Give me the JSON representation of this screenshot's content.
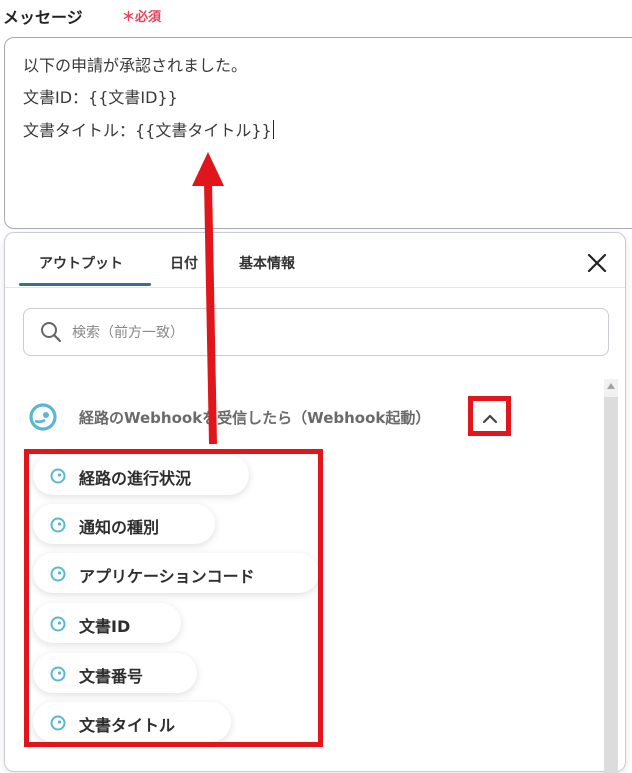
{
  "field": {
    "label": "メッセージ",
    "required": "＊必須"
  },
  "message": {
    "lines": [
      "以下の申請が承認されました。",
      "文書ID：{{文書ID}}",
      "文書タイトル：{{文書タイトル}}"
    ]
  },
  "tabs": [
    {
      "label": "アウトプット",
      "active": true
    },
    {
      "label": "日付",
      "active": false
    },
    {
      "label": "基本情報",
      "active": false
    }
  ],
  "search": {
    "placeholder": "検索（前方一致）"
  },
  "group": {
    "title": "経路のWebhookを受信したら（Webhook起動）",
    "icon": "webhook-icon",
    "expanded": true
  },
  "items": [
    {
      "label": "経路の進行状況",
      "icon": "webhook-small-icon"
    },
    {
      "label": "通知の種別",
      "icon": "webhook-small-icon"
    },
    {
      "label": "アプリケーションコード",
      "icon": "webhook-small-icon"
    },
    {
      "label": "文書ID",
      "icon": "webhook-small-icon"
    },
    {
      "label": "文書番号",
      "icon": "webhook-small-icon"
    },
    {
      "label": "文書タイトル",
      "icon": "webhook-small-icon"
    }
  ],
  "colors": {
    "accent": "#3b6f87",
    "annotation": "#e0161c",
    "required": "#e8435a",
    "icon": "#5ab7d3"
  }
}
